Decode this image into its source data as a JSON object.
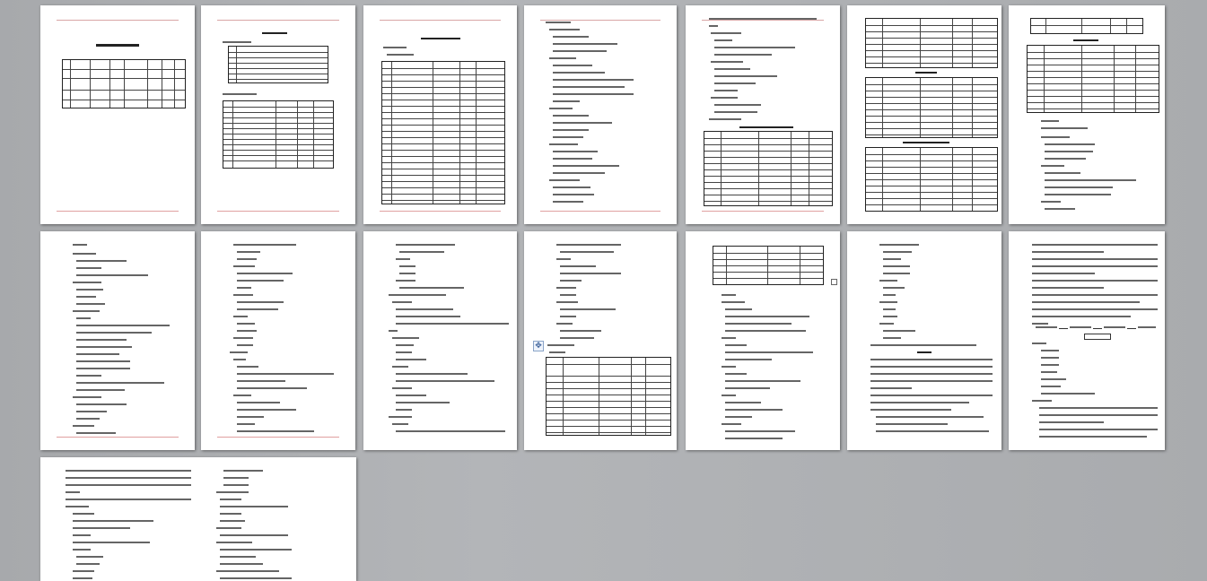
{
  "viewer": {
    "mode": "multi-page",
    "background_color": "#a9abae",
    "page_count": 16
  },
  "pages": [
    {
      "id": 1,
      "kind": "cover-table"
    },
    {
      "id": 2,
      "kind": "toc-tables"
    },
    {
      "id": 3,
      "kind": "heading-table"
    },
    {
      "id": 4,
      "kind": "text"
    },
    {
      "id": 5,
      "kind": "text-table"
    },
    {
      "id": 6,
      "kind": "tables"
    },
    {
      "id": 7,
      "kind": "table-text"
    },
    {
      "id": 8,
      "kind": "text"
    },
    {
      "id": 9,
      "kind": "text"
    },
    {
      "id": 10,
      "kind": "text"
    },
    {
      "id": 11,
      "kind": "text-table"
    },
    {
      "id": 12,
      "kind": "table-text"
    },
    {
      "id": 13,
      "kind": "text"
    },
    {
      "id": 14,
      "kind": "text-diagram"
    },
    {
      "id": 15,
      "kind": "text"
    },
    {
      "id": 16,
      "kind": "text"
    }
  ],
  "icons": {
    "move_handle": "four-way-arrow-icon",
    "resize_handle": "square-handle-icon"
  },
  "colors": {
    "header_rule": "#d8a6a6",
    "footer_rule": "#e0a0a0",
    "page_number": "#b8a6e6",
    "handle_border": "#8aa4c8"
  }
}
